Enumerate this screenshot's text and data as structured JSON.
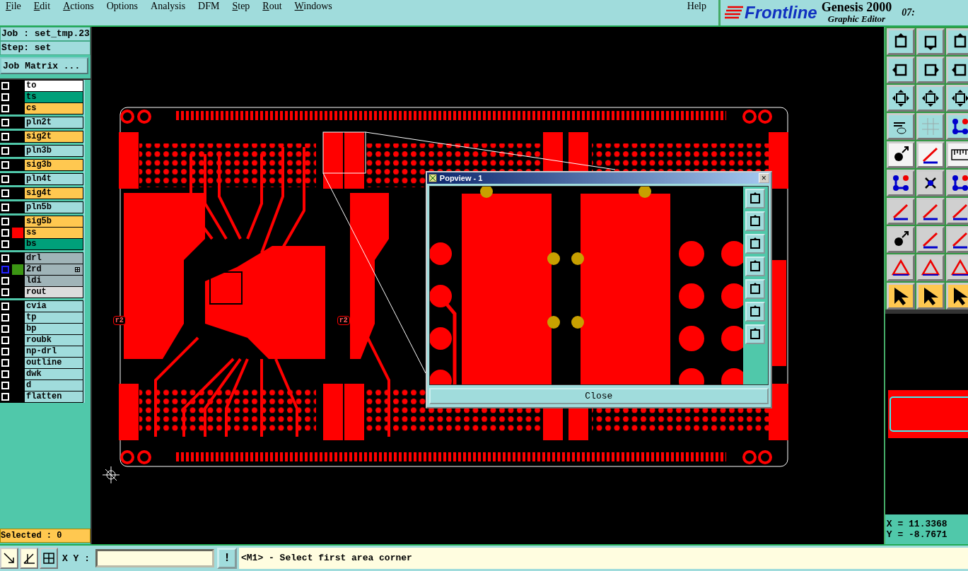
{
  "menu": [
    {
      "label": "File",
      "mnemonic": true
    },
    {
      "label": "Edit",
      "mnemonic": true
    },
    {
      "label": "Actions",
      "mnemonic": true
    },
    {
      "label": "Options",
      "mnemonic": false
    },
    {
      "label": "Analysis",
      "mnemonic": false
    },
    {
      "label": "DFM",
      "mnemonic": false
    },
    {
      "label": "Step",
      "mnemonic": true
    },
    {
      "label": "Rout",
      "mnemonic": true
    },
    {
      "label": "Windows",
      "mnemonic": true
    }
  ],
  "help": "Help",
  "logo": {
    "brand": "Frontline",
    "product": "Genesis 2000",
    "subtitle": "Graphic Editor"
  },
  "clock": "07:",
  "job": "Job : set_tmp.23",
  "step": "Step: set",
  "job_matrix_button": "Job Matrix ...",
  "layer_groups": [
    [
      {
        "name": "to",
        "kind": "silk",
        "selected": false,
        "marked": false
      },
      {
        "name": "ts",
        "kind": "mask",
        "selected": false,
        "marked": false
      },
      {
        "name": "cs",
        "kind": "signal",
        "selected": false,
        "marked": false
      }
    ],
    [
      {
        "name": "pln2t",
        "kind": "plane",
        "selected": false,
        "marked": false
      }
    ],
    [
      {
        "name": "sig2t",
        "kind": "signal",
        "selected": false,
        "marked": false
      }
    ],
    [
      {
        "name": "pln3b",
        "kind": "plane",
        "selected": false,
        "marked": false
      }
    ],
    [
      {
        "name": "sig3b",
        "kind": "signal",
        "selected": false,
        "marked": false
      }
    ],
    [
      {
        "name": "pln4t",
        "kind": "plane",
        "selected": false,
        "marked": false
      }
    ],
    [
      {
        "name": "sig4t",
        "kind": "signal",
        "selected": false,
        "marked": false
      }
    ],
    [
      {
        "name": "pln5b",
        "kind": "plane",
        "selected": false,
        "marked": false
      }
    ],
    [
      {
        "name": "sig5b",
        "kind": "signal",
        "selected": false,
        "marked": false
      },
      {
        "name": "ss",
        "kind": "signal",
        "color": "#ff0000",
        "selected": false,
        "marked": false
      },
      {
        "name": "bs",
        "kind": "mask",
        "selected": false,
        "marked": false
      }
    ],
    [
      {
        "name": "drl",
        "kind": "drill",
        "selected": false,
        "marked": false
      },
      {
        "name": "2rd",
        "kind": "drill",
        "color": "#3c9614",
        "selected": true,
        "marked": true
      },
      {
        "name": "ldi",
        "kind": "drill",
        "selected": false,
        "marked": false
      },
      {
        "name": "rout",
        "kind": "rout",
        "selected": false,
        "marked": false
      }
    ],
    [
      {
        "name": "cvia",
        "kind": "document",
        "selected": false,
        "marked": false
      },
      {
        "name": "tp",
        "kind": "document",
        "selected": false,
        "marked": false
      },
      {
        "name": "bp",
        "kind": "document",
        "selected": false,
        "marked": false
      },
      {
        "name": "roubk",
        "kind": "document",
        "selected": false,
        "marked": false
      },
      {
        "name": "np-drl",
        "kind": "document",
        "selected": false,
        "marked": false
      },
      {
        "name": "outline",
        "kind": "document",
        "selected": false,
        "marked": false
      },
      {
        "name": "dwk",
        "kind": "document",
        "selected": false,
        "marked": false
      },
      {
        "name": "d",
        "kind": "document",
        "selected": false,
        "marked": false
      },
      {
        "name": "flatten",
        "kind": "document",
        "selected": false,
        "marked": false
      }
    ]
  ],
  "selected_count": "Selected : 0",
  "board_labels": [
    "r2",
    "r2"
  ],
  "popview": {
    "title": "Popview - 1",
    "close_x": "×",
    "close_button": "Close"
  },
  "coords": {
    "x": "X = 11.3368",
    "y": "Y = -8.7671"
  },
  "command": {
    "label": "X Y :",
    "confirm": "!",
    "message": "<M1> - Select first area corner"
  }
}
